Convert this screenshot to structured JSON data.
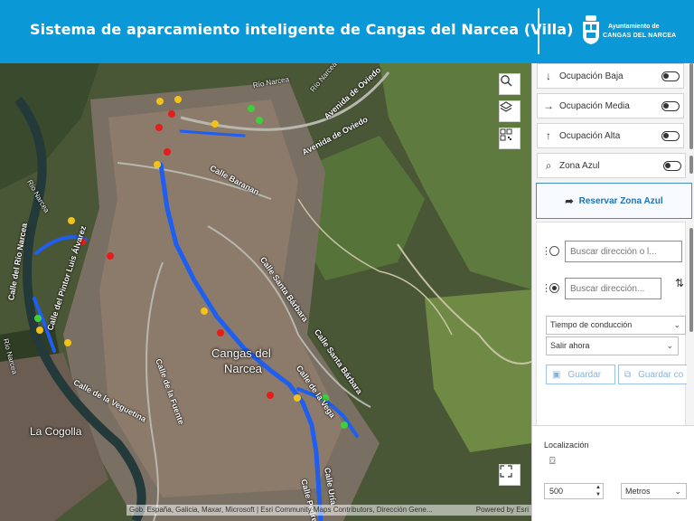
{
  "header": {
    "title": "Sistema de aparcamiento inteligente de Cangas del Narcea (Villa)",
    "logo_line1": "Ayuntamiento de",
    "logo_line2": "CANGAS DEL NARCEA"
  },
  "map": {
    "street_labels": [
      "Avenida de Oviedo",
      "Avenida de Oviedo",
      "Calle Baranan",
      "Calle del Río Narcea",
      "Calle del Pintor Luis Álvarez",
      "Calle Santa Bárbara",
      "Calle Santa Bárbara",
      "Calle de la Fuente",
      "Calle de la Vega",
      "Calle de la Veguetina",
      "Calle Uría",
      "Calle Pedregal",
      "Río Narcea",
      "Río Narcea",
      "Río Narcea",
      "Río Narcea"
    ],
    "place_labels": [
      "Cangas del",
      "Narcea",
      "La Cogolla"
    ],
    "attribution": "Gob. España, Galicia, Maxar, Microsoft | Esri Community Maps Contributors, Dirección Gene...",
    "powered_by": "Powered by Esri",
    "tools": [
      "search-icon",
      "layers-icon",
      "qr-code-icon",
      "fullscreen-icon"
    ],
    "colors": {
      "route": "#1e5ef0",
      "low": "#3ecf3a",
      "medium": "#f2c219",
      "high": "#e51d1d"
    }
  },
  "panel": {
    "filters": [
      {
        "arrow": "↓",
        "label": "Ocupación Baja"
      },
      {
        "arrow": "→",
        "label": "Ocupación Media"
      },
      {
        "arrow": "↑",
        "label": "Ocupación Alta"
      },
      {
        "arrow": "⌕",
        "label": "Zona Azul"
      }
    ],
    "reserve_label": "Reservar Zona Azul",
    "route": {
      "origin_placeholder": "Buscar dirección o l...",
      "destination_placeholder": "Buscar dirección...",
      "mode": "Tiempo de conducción",
      "departure": "Salir ahora",
      "save_label": "Guardar",
      "save_as_label": "Guardar co"
    },
    "location": {
      "title": "Localización",
      "distance": "500",
      "unit": "Metros"
    }
  }
}
